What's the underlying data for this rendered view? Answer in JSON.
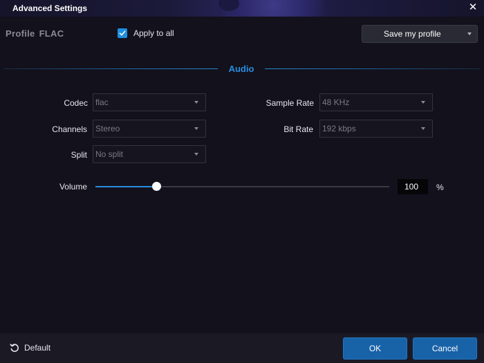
{
  "window": {
    "title": "Advanced Settings",
    "close_icon": "close-icon"
  },
  "header": {
    "profile_label": "Profile",
    "profile_value": "FLAC",
    "apply_to_all_label": "Apply to all",
    "apply_to_all_checked": true,
    "save_profile_label": "Save my profile"
  },
  "audio": {
    "section_title": "Audio",
    "codec": {
      "label": "Codec",
      "value": "flac"
    },
    "channels": {
      "label": "Channels",
      "value": "Stereo"
    },
    "split": {
      "label": "Split",
      "value": "No split"
    },
    "sample_rate": {
      "label": "Sample Rate",
      "value": "48 KHz"
    },
    "bit_rate": {
      "label": "Bit Rate",
      "value": "192 kbps"
    },
    "volume": {
      "label": "Volume",
      "value": "100",
      "unit": "%",
      "slider_fraction": 0.21
    }
  },
  "footer": {
    "default_label": "Default",
    "ok_label": "OK",
    "cancel_label": "Cancel"
  },
  "colors": {
    "accent": "#2a8ede",
    "button": "#1862a8",
    "background": "#12111c"
  }
}
